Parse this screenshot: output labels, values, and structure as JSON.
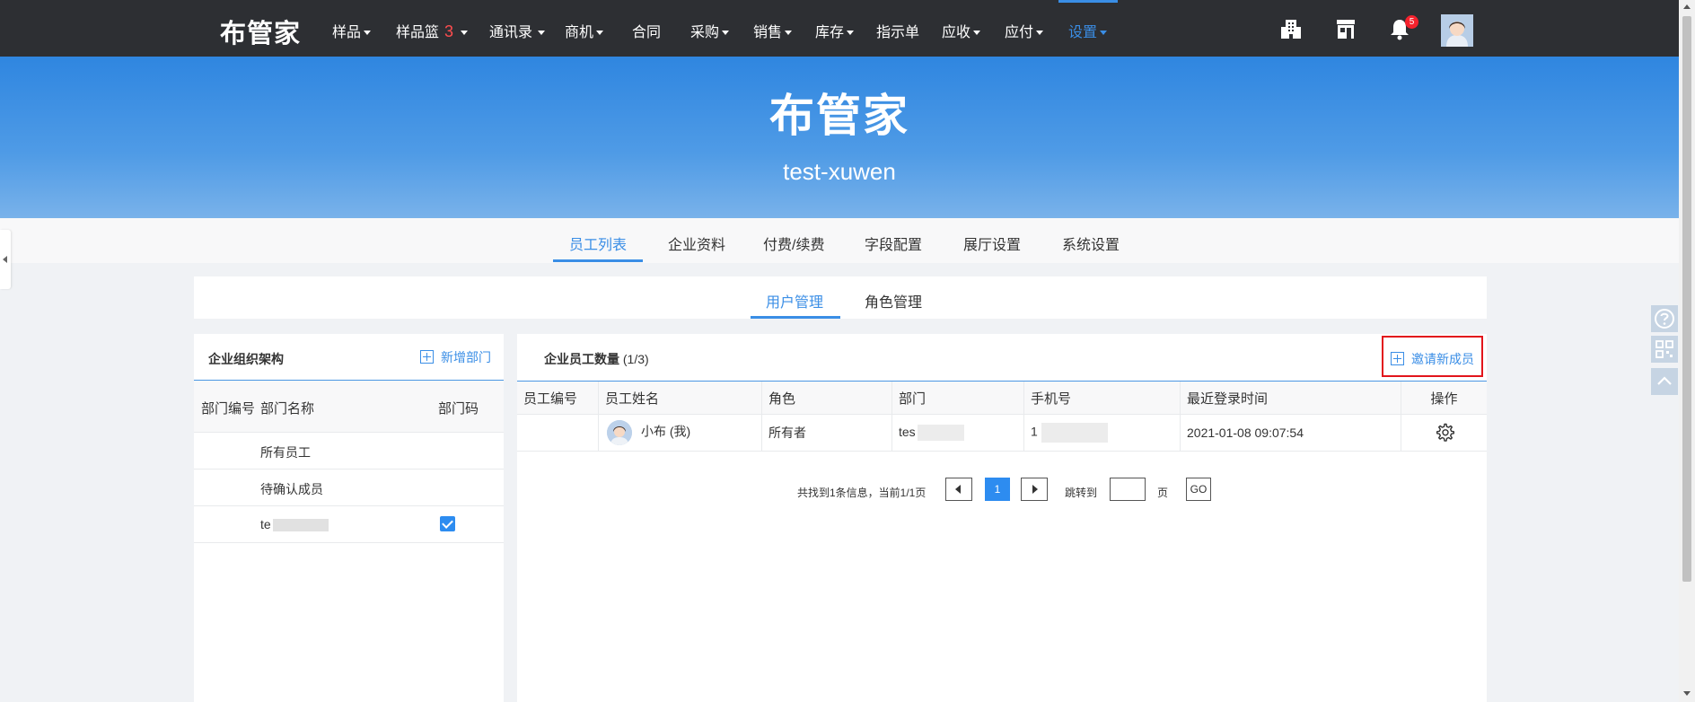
{
  "app": {
    "logo_text": "布管家"
  },
  "topnav": {
    "items": [
      {
        "label": "样品",
        "caret": true
      },
      {
        "label": "样品篮",
        "badge": "3",
        "caret": true
      },
      {
        "label": "通讯录",
        "caret": true
      },
      {
        "label": "商机",
        "caret": true
      },
      {
        "label": "合同",
        "caret": false
      },
      {
        "label": "采购",
        "caret": true
      },
      {
        "label": "销售",
        "caret": true
      },
      {
        "label": "库存",
        "caret": true
      },
      {
        "label": "指示单",
        "caret": false
      },
      {
        "label": "应收",
        "caret": true
      },
      {
        "label": "应付",
        "caret": true
      },
      {
        "label": "设置",
        "caret": true,
        "active": true
      }
    ],
    "notification_count": "5",
    "icons": [
      "building-icon",
      "store-icon",
      "bell-icon",
      "user-avatar"
    ]
  },
  "banner": {
    "title": "布管家",
    "subtitle": "test-xuwen"
  },
  "settings_tabs": [
    {
      "label": "员工列表",
      "active": true
    },
    {
      "label": "企业资料"
    },
    {
      "label": "付费/续费"
    },
    {
      "label": "字段配置"
    },
    {
      "label": "展厅设置"
    },
    {
      "label": "系统设置"
    }
  ],
  "sub_tabs": [
    {
      "label": "用户管理",
      "active": true
    },
    {
      "label": "角色管理"
    }
  ],
  "dept_panel": {
    "title": "企业组织架构",
    "add_label": "新增部门",
    "columns": [
      "部门编号",
      "部门名称",
      "部门码"
    ],
    "rows": [
      {
        "name": "所有员工",
        "checked": false
      },
      {
        "name": "待确认成员",
        "checked": false
      },
      {
        "name": "te",
        "redacted": true,
        "checked": true
      }
    ]
  },
  "employee_panel": {
    "title": "企业员工数量",
    "count": "(1/3)",
    "invite_label": "邀请新成员",
    "columns": [
      "员工编号",
      "员工姓名",
      "角色",
      "部门",
      "手机号",
      "最近登录时间",
      "操作"
    ],
    "rows": [
      {
        "id": "",
        "name": "小布 (我)",
        "role": "所有者",
        "dept": "tes",
        "phone": "1",
        "last_login": "2021-01-08 09:07:54",
        "action_icon": "gear-icon"
      }
    ]
  },
  "pagination": {
    "info": "共找到1条信息，当前1/1页",
    "current_page": "1",
    "jump_label": "跳转到",
    "jump_value": "",
    "page_unit": "页",
    "go_label": "GO"
  },
  "colors": {
    "nav_bg": "#2d2f33",
    "accent": "#3a8ee6",
    "owner_role": "#c9302c",
    "invite_highlight": "#e2151b"
  }
}
